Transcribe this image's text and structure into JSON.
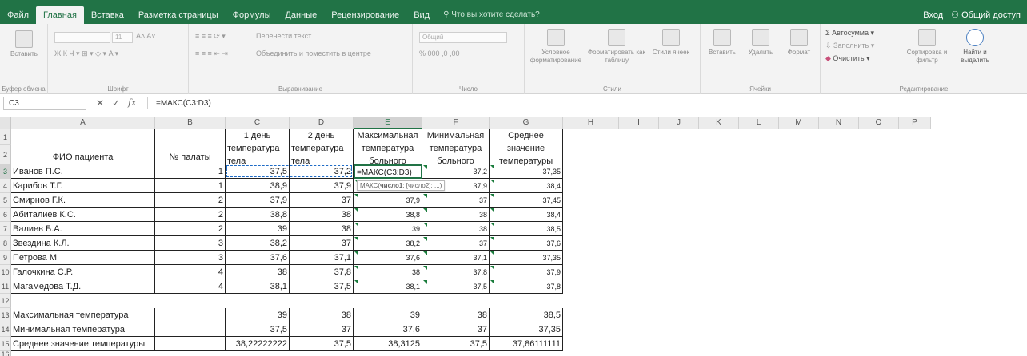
{
  "tabs": [
    "Файл",
    "Главная",
    "Вставка",
    "Разметка страницы",
    "Формулы",
    "Данные",
    "Рецензирование",
    "Вид"
  ],
  "active_tab": "Главная",
  "tell_me": "Что вы хотите сделать?",
  "account": {
    "signin": "Вход",
    "share": "Общий доступ"
  },
  "ribbon": {
    "clipboard": {
      "label": "Буфер обмена",
      "paste": "Вставить"
    },
    "font": {
      "label": "Шрифт",
      "size": "11"
    },
    "alignment": {
      "label": "Выравнивание",
      "wrap": "Перенести текст",
      "merge": "Объединить и поместить в центре"
    },
    "number": {
      "label": "Число",
      "format": "Общий"
    },
    "styles": {
      "label": "Стили",
      "cond": "Условное форматирование",
      "table": "Форматировать как таблицу",
      "cell": "Стили ячеек"
    },
    "cells": {
      "label": "Ячейки",
      "insert": "Вставить",
      "delete": "Удалить",
      "format": "Формат"
    },
    "editing": {
      "label": "Редактирование",
      "autosum": "Автосумма",
      "fill": "Заполнить",
      "clear": "Очистить",
      "sort": "Сортировка и фильтр",
      "find": "Найти и выделить"
    }
  },
  "formula_bar": {
    "name_box": "C3",
    "formula": "=МАКС(C3:D3)",
    "fx": "fx"
  },
  "columns": [
    "A",
    "B",
    "C",
    "D",
    "E",
    "F",
    "G",
    "H",
    "I",
    "J",
    "K",
    "L",
    "M",
    "N",
    "O",
    "P"
  ],
  "rows": [
    "1",
    "2",
    "3",
    "4",
    "5",
    "6",
    "7",
    "8",
    "9",
    "10",
    "11",
    "12",
    "13",
    "14",
    "15",
    "16"
  ],
  "headers": {
    "A": "ФИО пациента",
    "B": "№ палаты",
    "C": [
      "1 день",
      "температура",
      "тела"
    ],
    "D": [
      "2 день",
      "температура",
      "тела"
    ],
    "E": [
      "Максимальная",
      "температура",
      "больного"
    ],
    "F": [
      "Минимальная",
      "температура",
      "больного"
    ],
    "G": [
      "Среднее",
      "значение",
      "температуры"
    ]
  },
  "patients": [
    {
      "name": "Иванов П.С.",
      "ward": "1",
      "d1": "37,5",
      "d2": "37,2",
      "max": "=МАКС(C3:D3)",
      "min": "37,2",
      "avg": "37,35"
    },
    {
      "name": "Карибов Т.Г.",
      "ward": "1",
      "d1": "38,9",
      "d2": "37,9",
      "max": "",
      "min": "37,9",
      "avg": "38,4"
    },
    {
      "name": "Смирнов Г.К.",
      "ward": "2",
      "d1": "37,9",
      "d2": "37",
      "max": "37,9",
      "min": "37",
      "avg": "37,45"
    },
    {
      "name": "Абиталиев К.С.",
      "ward": "2",
      "d1": "38,8",
      "d2": "38",
      "max": "38,8",
      "min": "38",
      "avg": "38,4"
    },
    {
      "name": "Валиев Б.А.",
      "ward": "2",
      "d1": "39",
      "d2": "38",
      "max": "39",
      "min": "38",
      "avg": "38,5"
    },
    {
      "name": "Звездина К.Л.",
      "ward": "3",
      "d1": "38,2",
      "d2": "37",
      "max": "38,2",
      "min": "37",
      "avg": "37,6"
    },
    {
      "name": "Петрова М",
      "ward": "3",
      "d1": "37,6",
      "d2": "37,1",
      "max": "37,6",
      "min": "37,1",
      "avg": "37,35"
    },
    {
      "name": "Галочкина С.Р.",
      "ward": "4",
      "d1": "38",
      "d2": "37,8",
      "max": "38",
      "min": "37,8",
      "avg": "37,9"
    },
    {
      "name": "Магамедова Т.Д.",
      "ward": "4",
      "d1": "38,1",
      "d2": "37,5",
      "max": "38,1",
      "min": "37,5",
      "avg": "37,8"
    }
  ],
  "summary": [
    {
      "label": "Максимальная температура",
      "c": "39",
      "d": "38",
      "e": "39",
      "f": "38",
      "g": "38,5"
    },
    {
      "label": "Минимальная температура",
      "c": "37,5",
      "d": "37",
      "e": "37,6",
      "f": "37",
      "g": "37,35"
    },
    {
      "label": "Среднее значение температуры",
      "c": "38,22222222",
      "d": "37,5",
      "e": "38,3125",
      "f": "37,5",
      "g": "37,86111111"
    }
  ],
  "tooltip": {
    "fn": "МАКС(",
    "arg1": "число1",
    "rest": "; [число2]; ...)"
  },
  "accent": "#217346"
}
